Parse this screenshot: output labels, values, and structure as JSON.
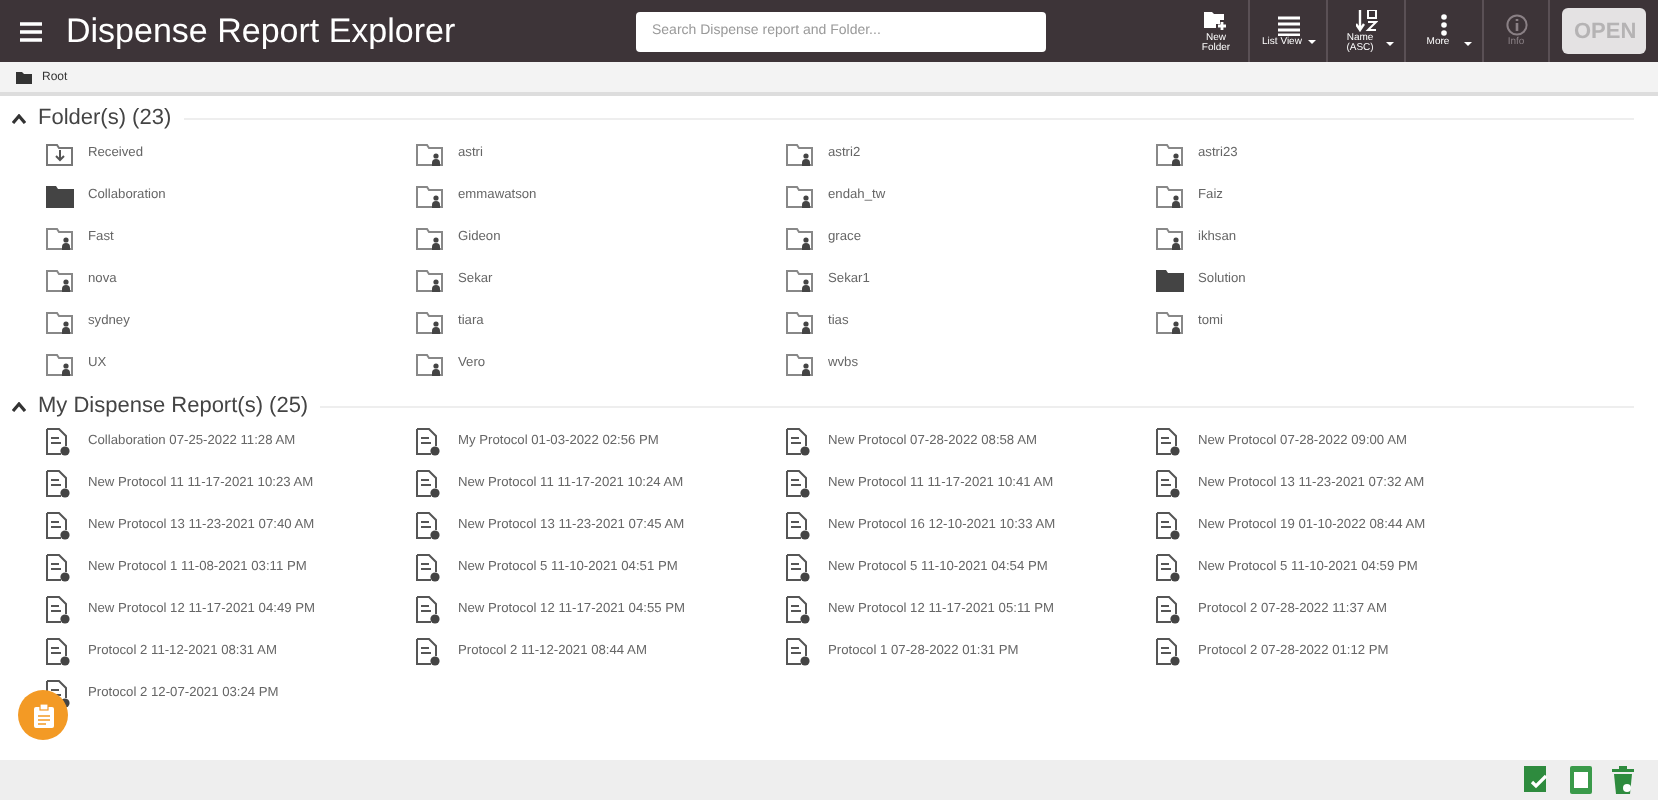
{
  "header": {
    "title": "Dispense Report Explorer",
    "search": {
      "placeholder": "Search Dispense report and Folder..."
    },
    "toolbar": [
      {
        "kind": "new-folder",
        "label": "New Folder",
        "dropdown": false,
        "disabled": false
      },
      {
        "kind": "list",
        "label": "List View",
        "dropdown": true,
        "disabled": false
      },
      {
        "kind": "sort",
        "label": "Name (ASC)",
        "dropdown": true,
        "disabled": false
      },
      {
        "kind": "more",
        "label": "More",
        "dropdown": true,
        "disabled": false
      },
      {
        "kind": "info",
        "label": "Info",
        "dropdown": false,
        "disabled": true
      }
    ],
    "open_button": {
      "label": "OPEN",
      "disabled": true
    }
  },
  "breadcrumb": {
    "label": "Root"
  },
  "sections": [
    {
      "title": "Folder(s) (23)",
      "expanded": true,
      "items": [
        {
          "name": "Received",
          "kind": "received"
        },
        {
          "name": "astri",
          "kind": "shared"
        },
        {
          "name": "astri2",
          "kind": "shared"
        },
        {
          "name": "astri23",
          "kind": "shared"
        },
        {
          "name": "Collaboration",
          "kind": "filled"
        },
        {
          "name": "emmawatson",
          "kind": "shared"
        },
        {
          "name": "endah_tw",
          "kind": "shared"
        },
        {
          "name": "Faiz",
          "kind": "shared"
        },
        {
          "name": "Fast",
          "kind": "shared"
        },
        {
          "name": "Gideon",
          "kind": "shared"
        },
        {
          "name": "grace",
          "kind": "shared"
        },
        {
          "name": "ikhsan",
          "kind": "shared"
        },
        {
          "name": "nova",
          "kind": "shared"
        },
        {
          "name": "Sekar",
          "kind": "shared"
        },
        {
          "name": "Sekar1",
          "kind": "shared"
        },
        {
          "name": "Solution",
          "kind": "filled"
        },
        {
          "name": "sydney",
          "kind": "shared"
        },
        {
          "name": "tiara",
          "kind": "shared"
        },
        {
          "name": "tias",
          "kind": "shared"
        },
        {
          "name": "tomi",
          "kind": "shared"
        },
        {
          "name": "UX",
          "kind": "shared"
        },
        {
          "name": "Vero",
          "kind": "shared"
        },
        {
          "name": "wvbs",
          "kind": "shared"
        }
      ]
    },
    {
      "title": "My Dispense Report(s) (25)",
      "expanded": true,
      "items": [
        {
          "name": "Collaboration 07-25-2022 11:28 AM",
          "kind": "report"
        },
        {
          "name": "My Protocol 01-03-2022 02:56 PM",
          "kind": "report"
        },
        {
          "name": "New Protocol 07-28-2022 08:58 AM",
          "kind": "report"
        },
        {
          "name": "New Protocol 07-28-2022 09:00 AM",
          "kind": "report"
        },
        {
          "name": "New Protocol 11 11-17-2021 10:23 AM",
          "kind": "report"
        },
        {
          "name": "New Protocol 11 11-17-2021 10:24 AM",
          "kind": "report"
        },
        {
          "name": "New Protocol 11 11-17-2021 10:41 AM",
          "kind": "report"
        },
        {
          "name": "New Protocol 13 11-23-2021 07:32 AM",
          "kind": "report"
        },
        {
          "name": "New Protocol 13 11-23-2021 07:40 AM",
          "kind": "report"
        },
        {
          "name": "New Protocol 13 11-23-2021 07:45 AM",
          "kind": "report"
        },
        {
          "name": "New Protocol 16 12-10-2021 10:33 AM",
          "kind": "report"
        },
        {
          "name": "New Protocol 19 01-10-2022 08:44 AM",
          "kind": "report"
        },
        {
          "name": "New Protocol 1 11-08-2021 03:11 PM",
          "kind": "report"
        },
        {
          "name": "New Protocol 5 11-10-2021 04:51 PM",
          "kind": "report"
        },
        {
          "name": "New Protocol 5 11-10-2021 04:54 PM",
          "kind": "report"
        },
        {
          "name": "New Protocol 5 11-10-2021 04:59 PM",
          "kind": "report"
        },
        {
          "name": "New Protocol 12 11-17-2021 04:49 PM",
          "kind": "report"
        },
        {
          "name": "New Protocol 12 11-17-2021 04:55 PM",
          "kind": "report"
        },
        {
          "name": "New Protocol 12 11-17-2021 05:11 PM",
          "kind": "report"
        },
        {
          "name": "Protocol 2 07-28-2022 11:37 AM",
          "kind": "report"
        },
        {
          "name": "Protocol 2 11-12-2021 08:31 AM",
          "kind": "report"
        },
        {
          "name": "Protocol 2 11-12-2021 08:44 AM",
          "kind": "report"
        },
        {
          "name": "Protocol 1 07-28-2022 01:31 PM",
          "kind": "report"
        },
        {
          "name": "Protocol 2 07-28-2022 01:12 PM",
          "kind": "report"
        },
        {
          "name": "Protocol 2 12-07-2021 03:24 PM",
          "kind": "report"
        }
      ]
    }
  ],
  "footer": {
    "actions": [
      {
        "kind": "checklist"
      },
      {
        "kind": "tablet"
      },
      {
        "kind": "trash"
      }
    ]
  }
}
